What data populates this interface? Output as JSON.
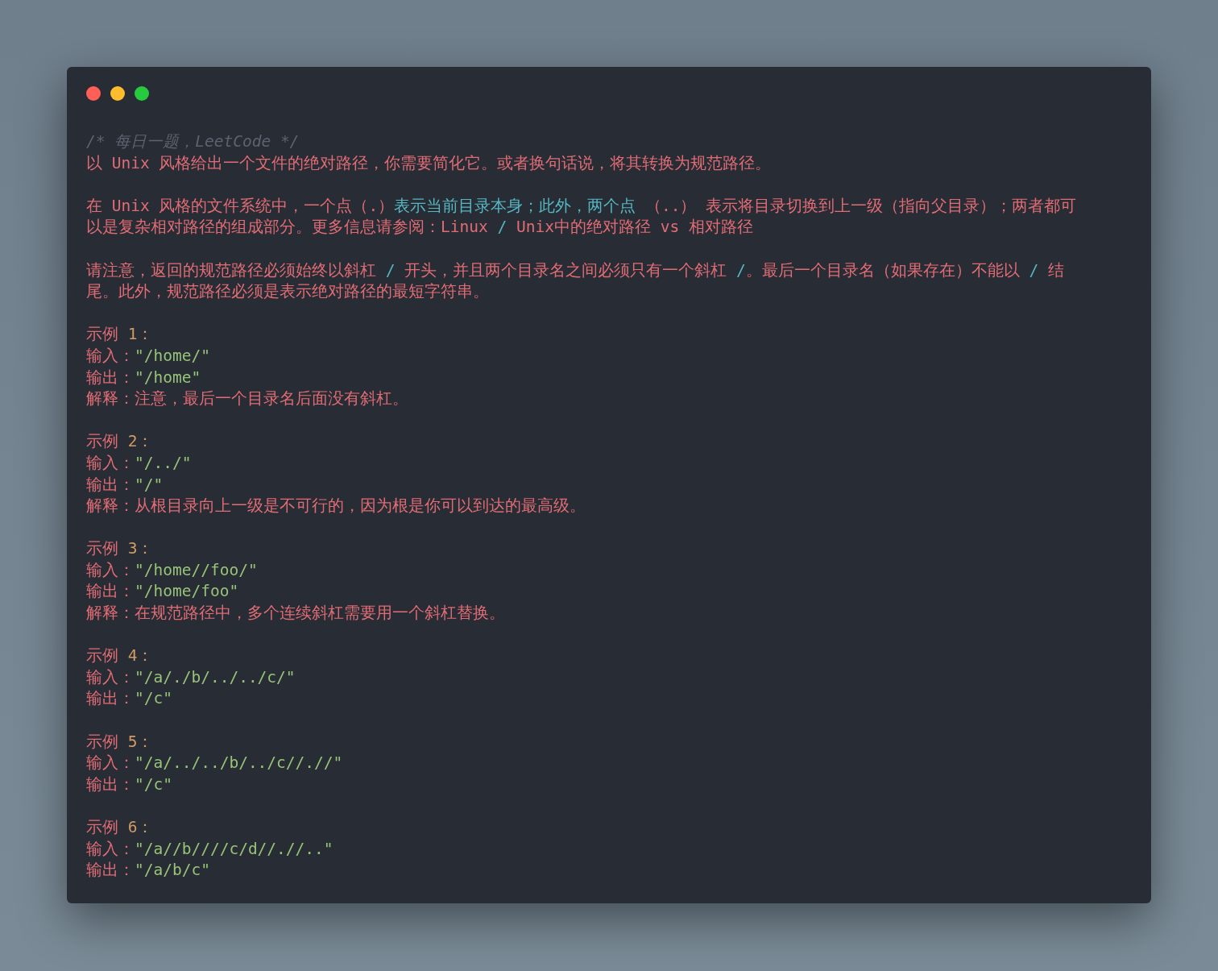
{
  "window": {
    "controls": [
      {
        "kind": "close"
      },
      {
        "kind": "minimize"
      },
      {
        "kind": "zoom"
      }
    ]
  },
  "code_blocks": [
    [
      [
        {
          "kind": "comment",
          "text": "/* 每日一题，LeetCode */"
        }
      ],
      [
        {
          "kind": "text",
          "text": "以 Unix 风格给出一个文件的绝对路径，你需要简化它。或者换句话说，将其转换为规范路径。"
        }
      ]
    ],
    [
      [
        {
          "kind": "text",
          "text": "在 Unix 风格的文件系统中，一个点（.）"
        },
        {
          "kind": "accent",
          "text": "表示当前目录本身；此外，两个点"
        },
        {
          "kind": "text",
          "text": " （..） 表示将目录切换到上一级（指向父目录）；两者都可"
        }
      ],
      [
        {
          "kind": "text",
          "text": "以是复杂相对路径的组成部分。更多信息请参阅：Linux "
        },
        {
          "kind": "accent",
          "text": "/"
        },
        {
          "kind": "text",
          "text": " Unix中的绝对路径 vs 相对路径"
        }
      ]
    ],
    [
      [
        {
          "kind": "text",
          "text": "请注意，返回的规范路径必须始终以斜杠 "
        },
        {
          "kind": "accent",
          "text": "/"
        },
        {
          "kind": "text",
          "text": " 开头，并且两个目录名之间必须只有一个斜杠 "
        },
        {
          "kind": "accent",
          "text": "/"
        },
        {
          "kind": "text",
          "text": "。最后一个目录名（如果存在）不能以 "
        },
        {
          "kind": "accent",
          "text": "/"
        },
        {
          "kind": "text",
          "text": " 结"
        }
      ],
      [
        {
          "kind": "text",
          "text": "尾。此外，规范路径必须是表示绝对路径的最短字符串。"
        }
      ]
    ],
    [
      [
        {
          "kind": "text",
          "text": "示例 "
        },
        {
          "kind": "number",
          "text": "1："
        }
      ],
      [
        {
          "kind": "text",
          "text": "输入："
        },
        {
          "kind": "string",
          "text": "\"/home/\""
        }
      ],
      [
        {
          "kind": "text",
          "text": "输出："
        },
        {
          "kind": "string",
          "text": "\"/home\""
        }
      ],
      [
        {
          "kind": "text",
          "text": "解释：注意，最后一个目录名后面没有斜杠。"
        }
      ]
    ],
    [
      [
        {
          "kind": "text",
          "text": "示例 "
        },
        {
          "kind": "number",
          "text": "2："
        }
      ],
      [
        {
          "kind": "text",
          "text": "输入："
        },
        {
          "kind": "string",
          "text": "\"/../\""
        }
      ],
      [
        {
          "kind": "text",
          "text": "输出："
        },
        {
          "kind": "string",
          "text": "\"/\""
        }
      ],
      [
        {
          "kind": "text",
          "text": "解释：从根目录向上一级是不可行的，因为根是你可以到达的最高级。"
        }
      ]
    ],
    [
      [
        {
          "kind": "text",
          "text": "示例 "
        },
        {
          "kind": "number",
          "text": "3："
        }
      ],
      [
        {
          "kind": "text",
          "text": "输入："
        },
        {
          "kind": "string",
          "text": "\"/home//foo/\""
        }
      ],
      [
        {
          "kind": "text",
          "text": "输出："
        },
        {
          "kind": "string",
          "text": "\"/home/foo\""
        }
      ],
      [
        {
          "kind": "text",
          "text": "解释：在规范路径中，多个连续斜杠需要用一个斜杠替换。"
        }
      ]
    ],
    [
      [
        {
          "kind": "text",
          "text": "示例 "
        },
        {
          "kind": "number",
          "text": "4："
        }
      ],
      [
        {
          "kind": "text",
          "text": "输入："
        },
        {
          "kind": "string",
          "text": "\"/a/./b/../../c/\""
        }
      ],
      [
        {
          "kind": "text",
          "text": "输出："
        },
        {
          "kind": "string",
          "text": "\"/c\""
        }
      ]
    ],
    [
      [
        {
          "kind": "text",
          "text": "示例 "
        },
        {
          "kind": "number",
          "text": "5："
        }
      ],
      [
        {
          "kind": "text",
          "text": "输入："
        },
        {
          "kind": "string",
          "text": "\"/a/../../b/../c//.//\""
        }
      ],
      [
        {
          "kind": "text",
          "text": "输出："
        },
        {
          "kind": "string",
          "text": "\"/c\""
        }
      ]
    ],
    [
      [
        {
          "kind": "text",
          "text": "示例 "
        },
        {
          "kind": "number",
          "text": "6："
        }
      ],
      [
        {
          "kind": "text",
          "text": "输入："
        },
        {
          "kind": "string",
          "text": "\"/a//b////c/d//.//..\""
        }
      ],
      [
        {
          "kind": "text",
          "text": "输出："
        },
        {
          "kind": "string",
          "text": "\"/a/b/c\""
        }
      ]
    ]
  ]
}
